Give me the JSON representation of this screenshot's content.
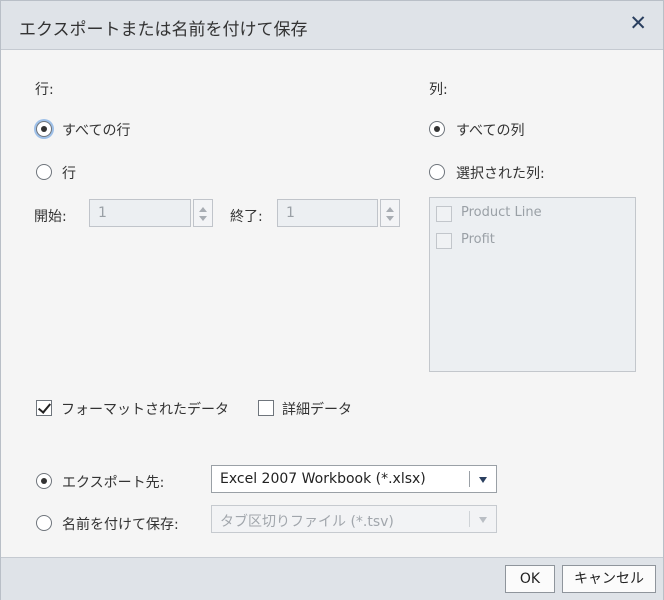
{
  "dialog": {
    "title": "エクスポートまたは名前を付けて保存",
    "close_glyph": "✕"
  },
  "rows": {
    "heading": "行:",
    "all_label": "すべての行",
    "range_label": "行",
    "start_label": "開始:",
    "start_value": "1",
    "end_label": "終了:",
    "end_value": "1"
  },
  "columns": {
    "heading": "列:",
    "all_label": "すべての列",
    "selected_label": "選択された列:",
    "items": [
      {
        "label": "Product Line"
      },
      {
        "label": "Profit"
      }
    ]
  },
  "options": {
    "formatted_label": "フォーマットされたデータ",
    "formatted_checked": true,
    "detail_label": "詳細データ",
    "detail_checked": false
  },
  "export": {
    "export_label": "エクスポート先:",
    "export_value": "Excel 2007 Workbook (*.xlsx)",
    "save_label": "名前を付けて保存:",
    "save_value": "タブ区切りファイル (*.tsv)"
  },
  "buttons": {
    "ok": "OK",
    "cancel": "キャンセル"
  },
  "colors": {
    "titlebar": "#dfe3e8",
    "accent": "#2a3f5f"
  }
}
